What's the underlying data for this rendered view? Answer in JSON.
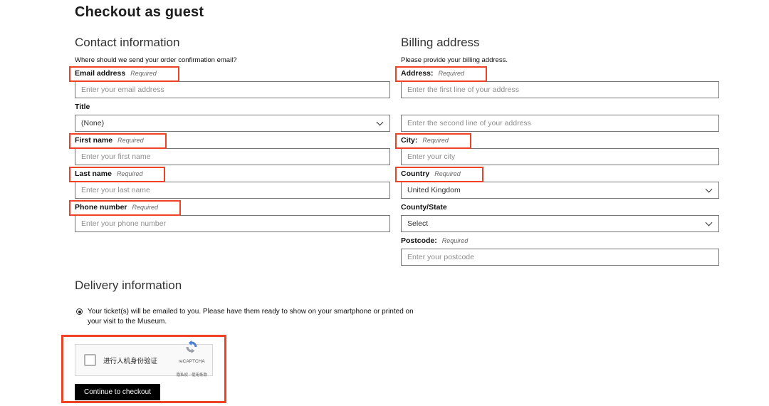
{
  "page": {
    "title": "Checkout as guest"
  },
  "contact": {
    "heading": "Contact information",
    "subheading": "Where should we send your order confirmation email?",
    "fields": [
      {
        "label": "Email address",
        "required": "Required",
        "flagged": true,
        "type": "input",
        "placeholder": "Enter your email address",
        "value": ""
      },
      {
        "label": "Title",
        "required": "",
        "flagged": false,
        "type": "select",
        "value": "(None)"
      },
      {
        "label": "First name",
        "required": "Required",
        "flagged": true,
        "type": "input",
        "placeholder": "Enter your first name",
        "value": ""
      },
      {
        "label": "Last name",
        "required": "Required",
        "flagged": true,
        "type": "input",
        "placeholder": "Enter your last name",
        "value": ""
      },
      {
        "label": "Phone number",
        "required": "Required",
        "flagged": true,
        "type": "input",
        "placeholder": "Enter your phone number",
        "value": ""
      }
    ]
  },
  "billing": {
    "heading": "Billing address",
    "subheading": "Please provide your billing address.",
    "fields": [
      {
        "label": "Address:",
        "required": "Required",
        "flagged": true,
        "type": "input",
        "placeholder": "Enter the first line of your address",
        "value": ""
      },
      {
        "label": "",
        "required": "",
        "flagged": false,
        "type": "input",
        "placeholder": "Enter the second line of your address",
        "value": ""
      },
      {
        "label": "City:",
        "required": "Required",
        "flagged": true,
        "type": "input",
        "placeholder": "Enter your city",
        "value": ""
      },
      {
        "label": "Country",
        "required": "Required",
        "flagged": true,
        "type": "select",
        "value": "United Kingdom"
      },
      {
        "label": "County/State",
        "required": "",
        "flagged": false,
        "type": "select",
        "value": "Select"
      },
      {
        "label": "Postcode:",
        "required": "Required",
        "flagged": false,
        "type": "input",
        "placeholder": "Enter your postcode",
        "value": ""
      }
    ]
  },
  "delivery": {
    "heading": "Delivery information",
    "option_text": "Your ticket(s) will be emailed to you. Please have them ready to show on your smartphone or printed on your visit to the Museum.",
    "option_selected": true
  },
  "captcha": {
    "checkbox_label": "进行人机身份验证",
    "brand": "reCAPTCHA",
    "links_text": "隐私权 - 使用条款",
    "checked": false
  },
  "actions": {
    "continue_label": "Continue to checkout"
  },
  "colors": {
    "annotation": "#ef4123",
    "button_bg": "#000000",
    "button_text": "#ffffff",
    "captcha_bg": "#f9f9f9",
    "input_border": "#767676"
  }
}
